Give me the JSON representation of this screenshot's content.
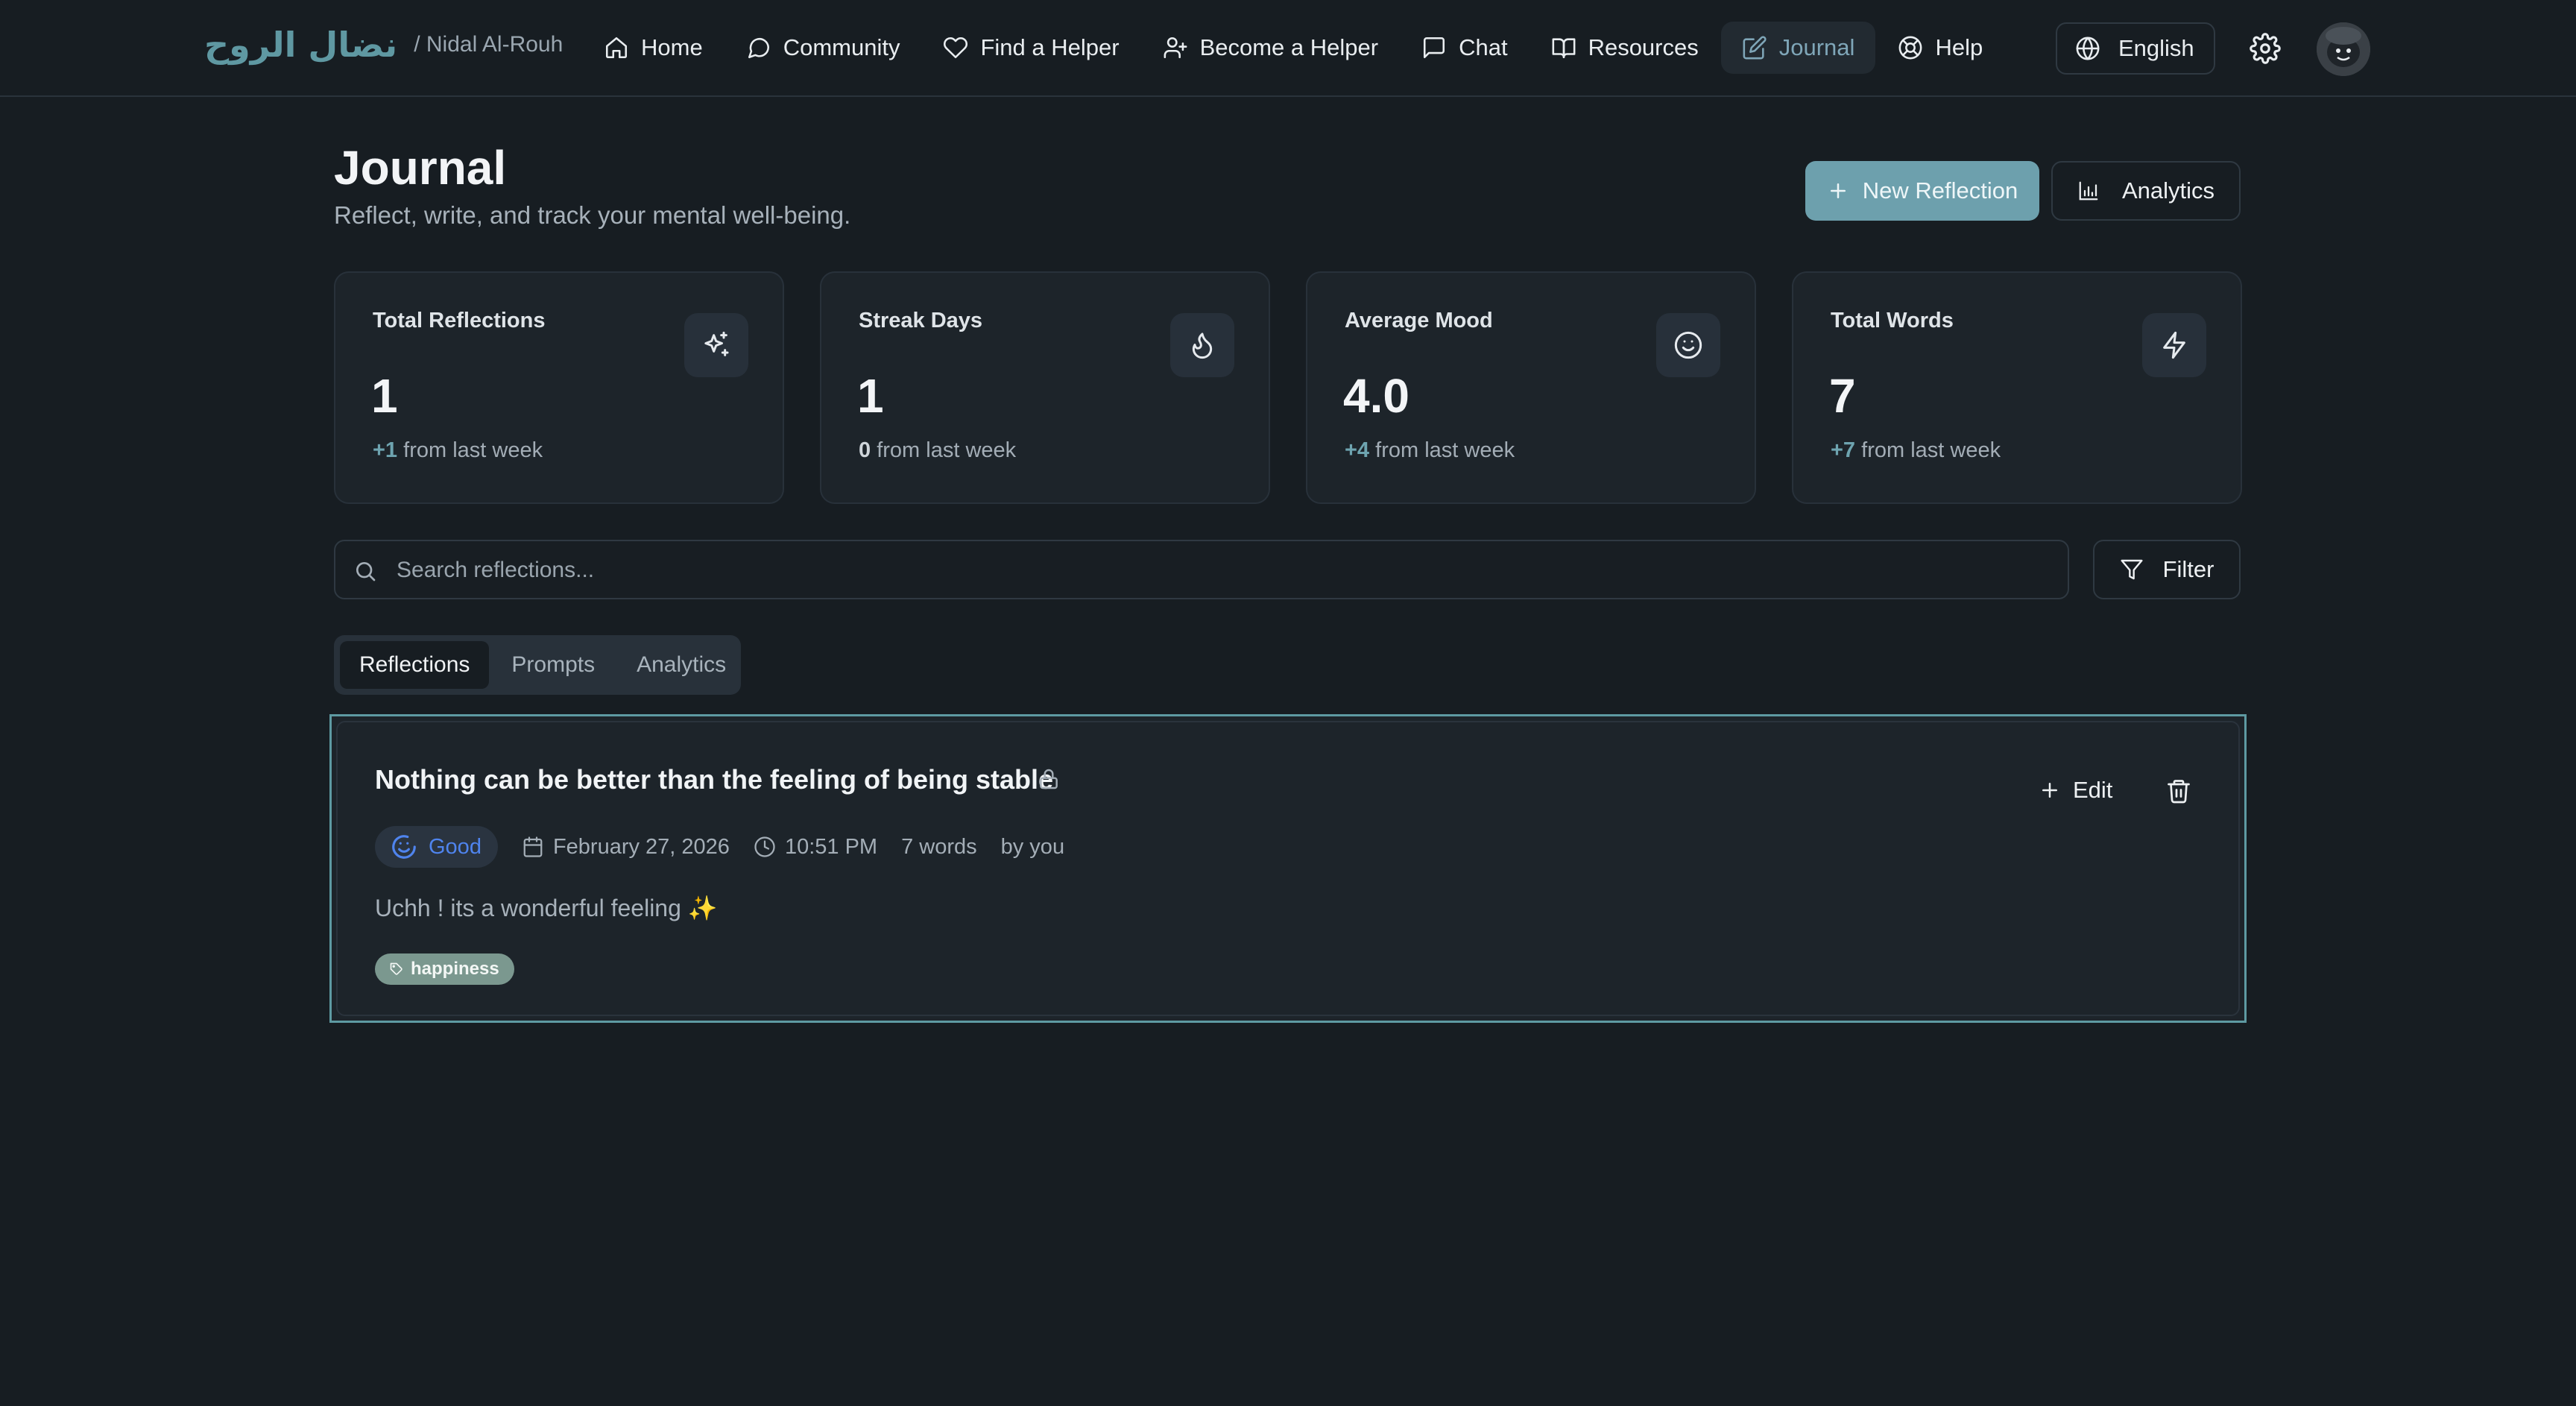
{
  "app": {
    "brand_name": "نضال الروح",
    "user_path": "/ Nidal Al-Rouh",
    "accent_color": "#6da0ad",
    "background_color": "#171d22"
  },
  "nav": {
    "items": [
      {
        "label": "Home",
        "icon": "home-icon"
      },
      {
        "label": "Community",
        "icon": "message-circle-icon"
      },
      {
        "label": "Find a Helper",
        "icon": "heart-icon"
      },
      {
        "label": "Become a Helper",
        "icon": "user-plus-icon"
      },
      {
        "label": "Chat",
        "icon": "message-square-icon"
      },
      {
        "label": "Resources",
        "icon": "book-open-icon"
      },
      {
        "label": "Journal",
        "icon": "edit-icon",
        "active": true
      },
      {
        "label": "Help",
        "icon": "life-buoy-icon"
      }
    ],
    "language": "English"
  },
  "header": {
    "title": "Journal",
    "subtitle": "Reflect, write, and track your mental well-being.",
    "new_reflection": "New Reflection",
    "analytics": "Analytics"
  },
  "stats": [
    {
      "label": "Total Reflections",
      "value": "1",
      "delta": "+1",
      "suffix": "from last week",
      "icon": "sparkles-icon"
    },
    {
      "label": "Streak Days",
      "value": "1",
      "delta": "0",
      "suffix": "from last week",
      "icon": "flame-icon"
    },
    {
      "label": "Average Mood",
      "value": "4.0",
      "delta": "+4",
      "suffix": "from last week",
      "icon": "smile-icon"
    },
    {
      "label": "Total Words",
      "value": "7",
      "delta": "+7",
      "suffix": "from last week",
      "icon": "zap-icon"
    }
  ],
  "search": {
    "placeholder": "Search reflections...",
    "value": "",
    "filter_label": "Filter"
  },
  "tabs": [
    {
      "label": "Reflections",
      "active": true
    },
    {
      "label": "Prompts",
      "active": false
    },
    {
      "label": "Analytics",
      "active": false
    }
  ],
  "reflections": [
    {
      "title": "Nothing can be better than the feeling of being stable",
      "mood": "Good",
      "date": "February 27, 2026",
      "time": "10:51 PM",
      "words": "7 words",
      "author": "by you",
      "body": "Uchh ! its a wonderful feeling ✨",
      "tags": [
        "happiness"
      ],
      "edit_label": "Edit"
    }
  ]
}
